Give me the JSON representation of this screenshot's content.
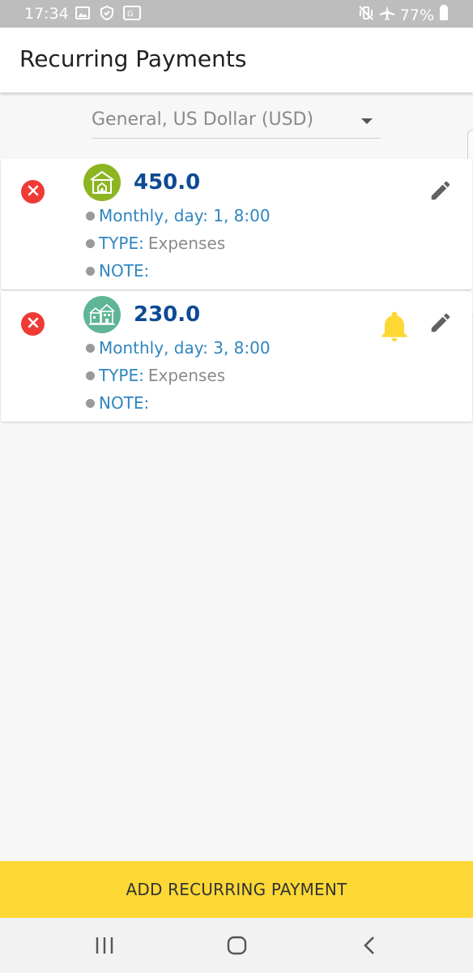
{
  "status_bar": {
    "time": "17:34",
    "battery": "77%",
    "icons": [
      "gallery-icon",
      "shield-icon",
      "translate-icon",
      "mute-vibrate-icon",
      "airplane-icon",
      "battery-icon"
    ]
  },
  "app_bar": {
    "title": "Recurring Payments"
  },
  "account_selector": {
    "value": "General, US Dollar (USD)"
  },
  "payments": [
    {
      "amount": "450.0",
      "icon": "house-icon",
      "icon_color": "#8db522",
      "schedule": "Monthly, day: 1, 8:00",
      "type_label": "TYPE:",
      "type_value": "Expenses",
      "note_label": "NOTE:",
      "note_value": "",
      "has_reminder": false
    },
    {
      "amount": "230.0",
      "icon": "buildings-icon",
      "icon_color": "#5fb595",
      "schedule": "Monthly, day: 3, 8:00",
      "type_label": "TYPE:",
      "type_value": "Expenses",
      "note_label": "NOTE:",
      "note_value": "",
      "has_reminder": true
    }
  ],
  "colors": {
    "accent": "#fdd835",
    "delete": "#ef3a35",
    "amount": "#0e4a94",
    "label": "#2f86c1",
    "bell": "#fdd835"
  },
  "add_button": {
    "label": "ADD RECURRING PAYMENT"
  }
}
